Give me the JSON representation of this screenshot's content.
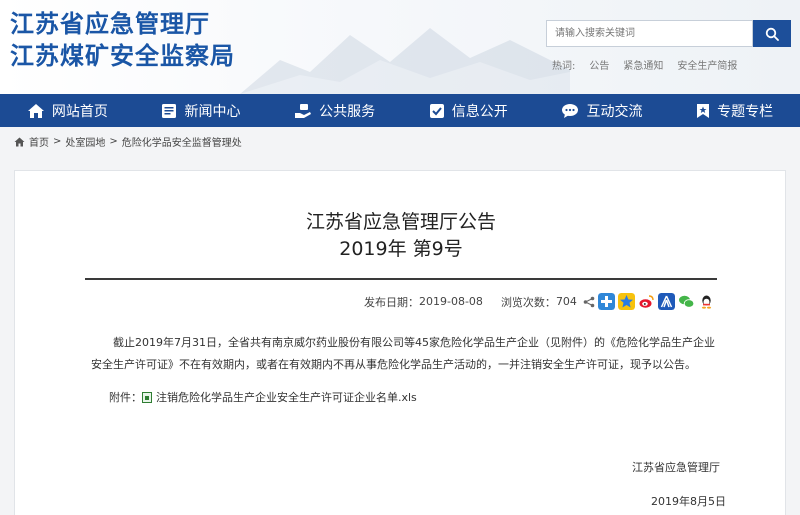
{
  "header": {
    "logo_line1": "江苏省应急管理厅",
    "logo_line2": "江苏煤矿安全监察局",
    "brand_color": "#1a56a6"
  },
  "search": {
    "placeholder": "请输入搜索关键词",
    "button_icon": "search-icon"
  },
  "hotwords": {
    "label": "热词:",
    "items": [
      "公告",
      "紧急通知",
      "安全生产简报"
    ]
  },
  "nav": {
    "background": "#1c4b94",
    "items": [
      {
        "label": "网站首页",
        "icon": "home-icon"
      },
      {
        "label": "新闻中心",
        "icon": "newspaper-icon"
      },
      {
        "label": "公共服务",
        "icon": "service-hand-icon"
      },
      {
        "label": "信息公开",
        "icon": "info-check-icon"
      },
      {
        "label": "互动交流",
        "icon": "chat-icon"
      },
      {
        "label": "专题专栏",
        "icon": "bookmark-star-icon"
      }
    ]
  },
  "breadcrumb": {
    "home_icon": "home-icon",
    "items": [
      "首页",
      "处室园地",
      "危险化学品安全监督管理处"
    ],
    "separator": ">"
  },
  "article": {
    "title_line1": "江苏省应急管理厅公告",
    "title_line2": "2019年 第9号",
    "publish_label": "发布日期：",
    "publish_date": "2019-08-08",
    "views_label": "浏览次数：",
    "views": "704",
    "share_icons": [
      "share-icon",
      "plus-share-icon",
      "qzone-icon",
      "weibo-icon",
      "renren-icon",
      "wechat-icon",
      "qq-icon"
    ],
    "body": "截止2019年7月31日，全省共有南京威尔药业股份有限公司等45家危险化学品生产企业（见附件）的《危险化学品生产企业安全生产许可证》不在有效期内，或者在有效期内不再从事危险化学品生产活动的，一并注销安全生产许可证，现予以公告。",
    "attachment_label": "附件：",
    "attachment_name": "注销危险化学品生产企业安全生产许可证企业名单.xls",
    "signature_org": "江苏省应急管理厅",
    "signature_date": "2019年8月5日"
  }
}
